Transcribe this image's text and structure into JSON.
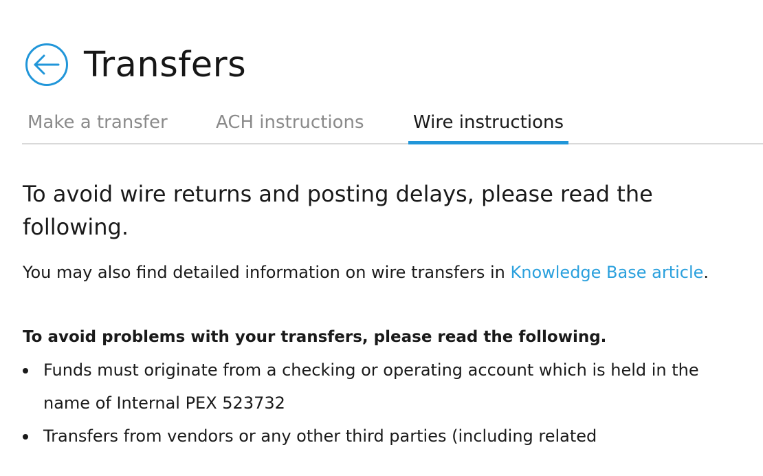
{
  "header": {
    "title": "Transfers",
    "back_icon": "arrow-left-circle-icon",
    "accent_color": "#2196d9"
  },
  "tabs": [
    {
      "label": "Make a transfer",
      "active": false
    },
    {
      "label": "ACH instructions",
      "active": false
    },
    {
      "label": "Wire instructions",
      "active": true
    }
  ],
  "content": {
    "intro": "To avoid wire returns and posting delays, please read the following.",
    "kb_prefix": "You may also find detailed information on wire transfers in ",
    "kb_link_label": "Knowledge Base article",
    "kb_suffix": ".",
    "rules_heading": "To avoid problems with your transfers, please read the following.",
    "rules": [
      "Funds must originate from a checking or operating account which is held in the name of Internal PEX 523732",
      "Transfers from vendors or any other third parties (including related"
    ]
  }
}
